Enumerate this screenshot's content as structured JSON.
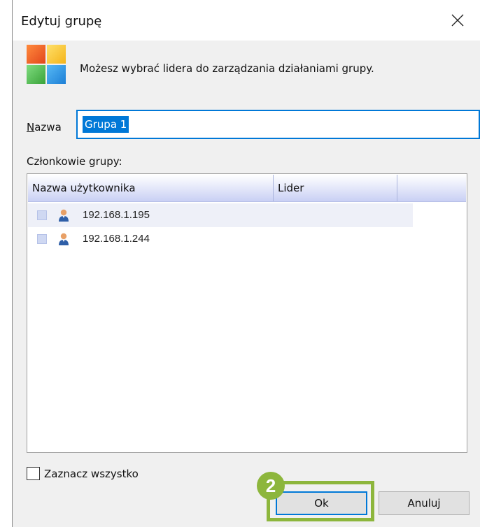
{
  "window": {
    "title": "Edytuj grupę"
  },
  "info": {
    "text": "Możesz wybrać lidera do zarządzania działaniami grupy."
  },
  "name_field": {
    "label_first": "N",
    "label_rest": "azwa",
    "value": "Grupa 1"
  },
  "members": {
    "label": "Członkowie grupy:",
    "columns": [
      "Nazwa użytkownika",
      "Lider"
    ],
    "rows": [
      {
        "user": "192.168.1.195"
      },
      {
        "user": "192.168.1.244"
      }
    ]
  },
  "select_all": {
    "label": "Zaznacz wszystko"
  },
  "buttons": {
    "ok": "Ok",
    "cancel": "Anuluj"
  },
  "annotation": {
    "step": "2"
  },
  "colors": {
    "accent": "#0078d7",
    "highlight": "#8db63c"
  }
}
